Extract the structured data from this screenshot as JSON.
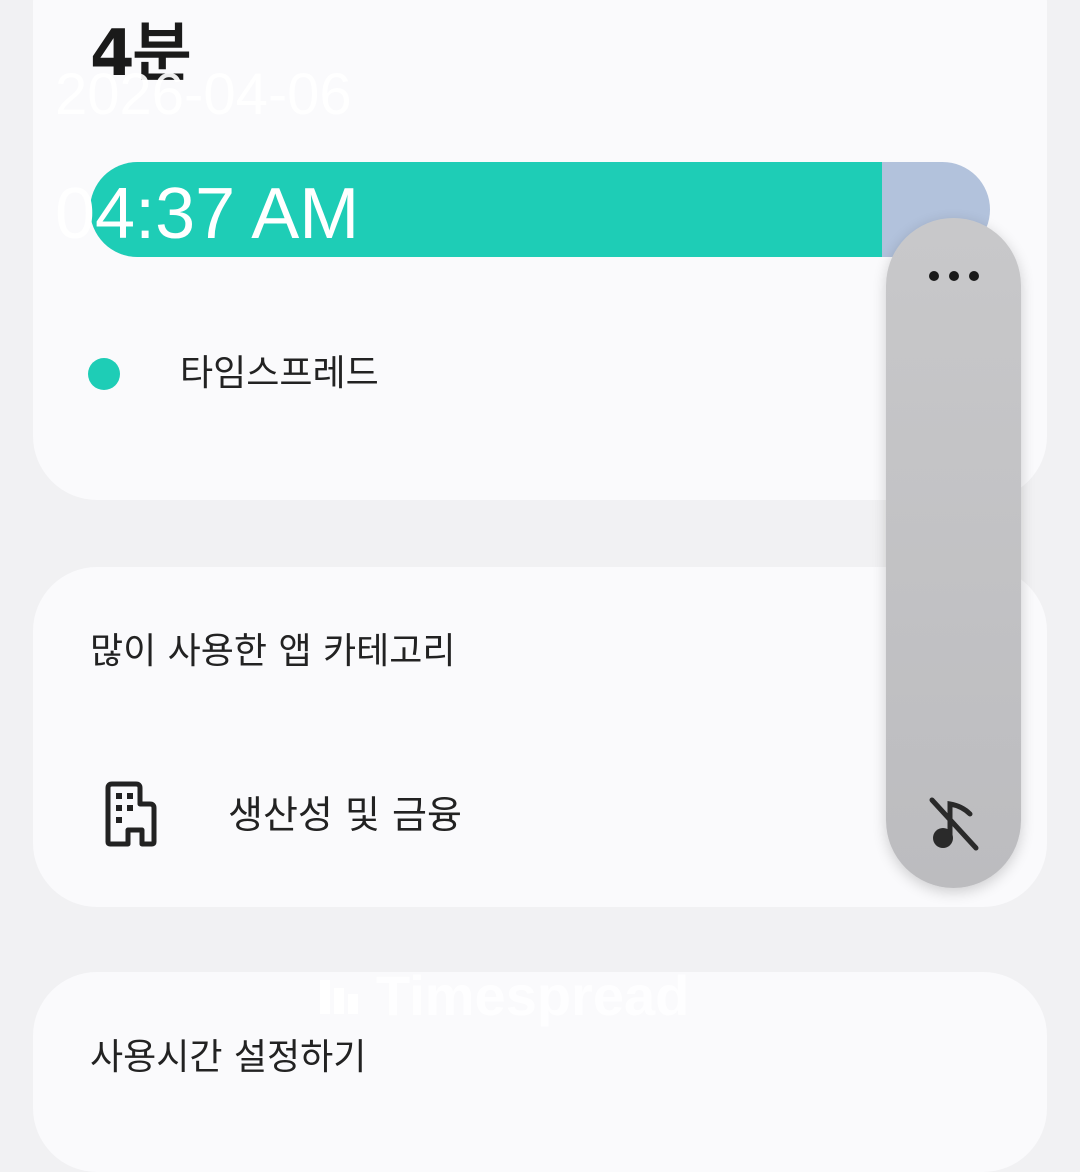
{
  "usage_card": {
    "minutes_label": "4분",
    "bar": {
      "fill_percent": 88,
      "fill_color": "#1ecdb6",
      "rest_color": "#b2c2dc"
    },
    "legend": {
      "dot_color": "#1ecdb6",
      "label": "타임스프레드"
    }
  },
  "timestamp": {
    "date": "2026-04-06",
    "time": "04:37 AM"
  },
  "categories_card": {
    "title": "많이 사용한 앱 카테고리",
    "item": {
      "icon": "building-icon",
      "label": "생산성 및 금융"
    }
  },
  "limit_card": {
    "title": "사용시간 설정하기"
  },
  "watermark": {
    "text": "Timespread",
    "icon": "timespread-logo-icon"
  },
  "edge_panel": {
    "top_icon": "more-horizontal-icon",
    "bottom_icon": "music-off-icon"
  }
}
